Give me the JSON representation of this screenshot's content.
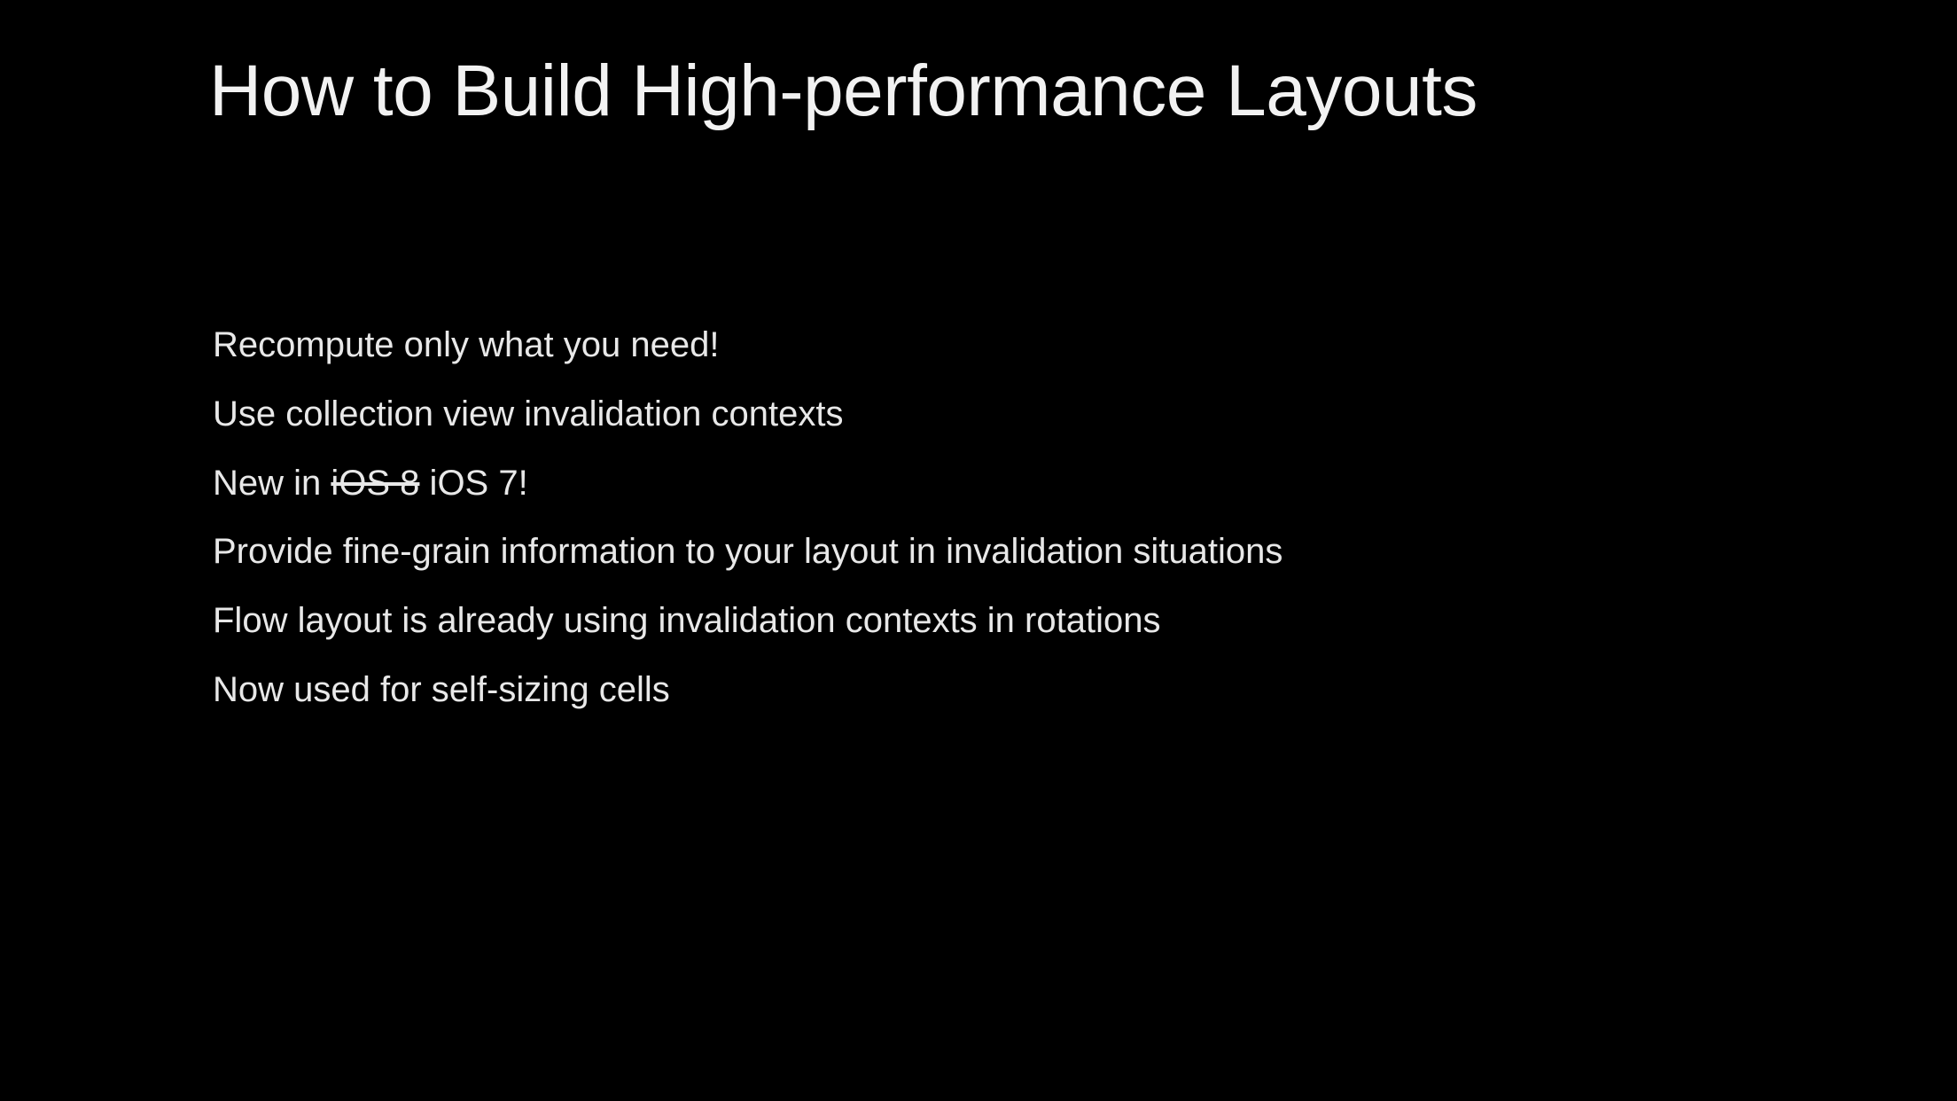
{
  "slide": {
    "title": "How to Build High-performance Layouts",
    "bullets": [
      "Recompute only what you need!",
      "Use collection view invalidation contexts",
      {
        "prefix": "New in ",
        "struck": "iOS 8",
        "suffix": " iOS 7!"
      },
      "Provide fine-grain information to your layout in invalidation situations",
      "Flow layout is already using invalidation contexts in rotations",
      "Now used for self-sizing cells"
    ]
  }
}
